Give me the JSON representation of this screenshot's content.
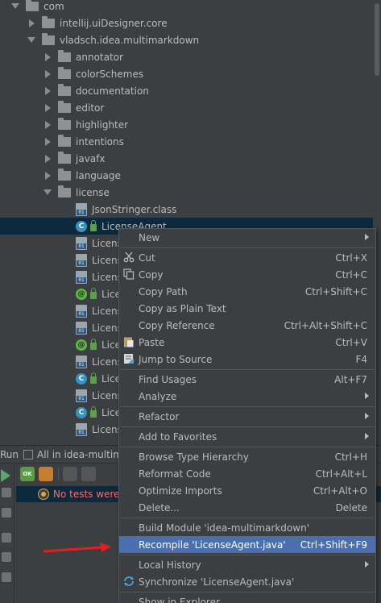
{
  "tree": {
    "items": [
      {
        "label": "com",
        "level": 0,
        "state": "expanded",
        "icon": "folder-icon"
      },
      {
        "label": "intellij.uiDesigner.core",
        "level": 1,
        "state": "collapsed",
        "icon": "folder-icon"
      },
      {
        "label": "vladsch.idea.multimarkdown",
        "level": 1,
        "state": "expanded",
        "icon": "folder-icon"
      },
      {
        "label": "annotator",
        "level": 2,
        "state": "collapsed",
        "icon": "folder-icon"
      },
      {
        "label": "colorSchemes",
        "level": 2,
        "state": "collapsed",
        "icon": "folder-icon"
      },
      {
        "label": "documentation",
        "level": 2,
        "state": "collapsed",
        "icon": "folder-icon"
      },
      {
        "label": "editor",
        "level": 2,
        "state": "collapsed",
        "icon": "folder-icon"
      },
      {
        "label": "highlighter",
        "level": 2,
        "state": "collapsed",
        "icon": "folder-icon"
      },
      {
        "label": "intentions",
        "level": 2,
        "state": "collapsed",
        "icon": "folder-icon"
      },
      {
        "label": "javafx",
        "level": 2,
        "state": "collapsed",
        "icon": "folder-icon"
      },
      {
        "label": "language",
        "level": 2,
        "state": "collapsed",
        "icon": "folder-icon"
      },
      {
        "label": "license",
        "level": 2,
        "state": "expanded",
        "icon": "folder-icon"
      },
      {
        "label": "JsonStringer.class",
        "level": 3,
        "icon": "class-file-icon"
      },
      {
        "label": "LicenseAgent",
        "level": 3,
        "icon": "class-icon",
        "selected": true
      },
      {
        "label": "Licens",
        "level": 3,
        "icon": "class-file-icon"
      },
      {
        "label": "Licens",
        "level": 3,
        "icon": "class-file-icon"
      },
      {
        "label": "Licens",
        "level": 3,
        "icon": "class-file-icon"
      },
      {
        "label": "Lice",
        "level": 3,
        "icon": "annotation-icon"
      },
      {
        "label": "Licens",
        "level": 3,
        "icon": "class-file-icon"
      },
      {
        "label": "Licens",
        "level": 3,
        "icon": "class-file-icon"
      },
      {
        "label": "Lice",
        "level": 3,
        "icon": "annotation-icon"
      },
      {
        "label": "Licens",
        "level": 3,
        "icon": "class-file-icon"
      },
      {
        "label": "Lice",
        "level": 3,
        "icon": "class-icon"
      },
      {
        "label": "Licens",
        "level": 3,
        "icon": "class-file-icon"
      },
      {
        "label": "Lice",
        "level": 3,
        "icon": "class-icon"
      },
      {
        "label": "Licens",
        "level": 3,
        "icon": "class-file-icon"
      }
    ]
  },
  "run_panel": {
    "run_label": "Run",
    "tab_label": "All in idea-multimark",
    "ok_badge": "OK",
    "status_text": "No tests were"
  },
  "context_menu": {
    "items": [
      {
        "label": "New",
        "shortcut": "",
        "submenu": true,
        "icon": ""
      },
      {
        "sep": true
      },
      {
        "label": "Cut",
        "shortcut": "Ctrl+X",
        "icon": "scissors-icon"
      },
      {
        "label": "Copy",
        "shortcut": "Ctrl+C",
        "icon": "copy-icon"
      },
      {
        "label": "Copy Path",
        "shortcut": "Ctrl+Shift+C",
        "icon": ""
      },
      {
        "label": "Copy as Plain Text",
        "shortcut": "",
        "icon": ""
      },
      {
        "label": "Copy Reference",
        "shortcut": "Ctrl+Alt+Shift+C",
        "icon": ""
      },
      {
        "label": "Paste",
        "shortcut": "Ctrl+V",
        "icon": "paste-icon"
      },
      {
        "label": "Jump to Source",
        "shortcut": "F4",
        "icon": "jump-icon"
      },
      {
        "sep": true
      },
      {
        "label": "Find Usages",
        "shortcut": "Alt+F7",
        "icon": ""
      },
      {
        "label": "Analyze",
        "shortcut": "",
        "submenu": true,
        "icon": ""
      },
      {
        "sep": true
      },
      {
        "label": "Refactor",
        "shortcut": "",
        "submenu": true,
        "icon": ""
      },
      {
        "sep": true
      },
      {
        "label": "Add to Favorites",
        "shortcut": "",
        "submenu": true,
        "icon": ""
      },
      {
        "sep": true
      },
      {
        "label": "Browse Type Hierarchy",
        "shortcut": "Ctrl+H",
        "icon": ""
      },
      {
        "label": "Reformat Code",
        "shortcut": "Ctrl+Alt+L",
        "icon": ""
      },
      {
        "label": "Optimize Imports",
        "shortcut": "Ctrl+Alt+O",
        "icon": ""
      },
      {
        "label": "Delete...",
        "shortcut": "Delete",
        "icon": ""
      },
      {
        "sep": true
      },
      {
        "label": "Build Module 'idea-multimarkdown'",
        "shortcut": "",
        "icon": ""
      },
      {
        "label": "Recompile 'LicenseAgent.java'",
        "shortcut": "Ctrl+Shift+F9",
        "icon": "",
        "highlighted": true
      },
      {
        "sep": true
      },
      {
        "label": "Local History",
        "shortcut": "",
        "submenu": true,
        "icon": ""
      },
      {
        "label": "Synchronize 'LicenseAgent.java'",
        "shortcut": "",
        "icon": "sync-icon"
      },
      {
        "sep": true
      },
      {
        "label": "Show in Explorer",
        "shortcut": "",
        "icon": ""
      }
    ]
  },
  "colors": {
    "background": "#3c3f41",
    "selection": "#0d293e",
    "menu_highlight": "#4b6eaf",
    "arrow": "#e02020",
    "error_text": "#ff6b68"
  }
}
